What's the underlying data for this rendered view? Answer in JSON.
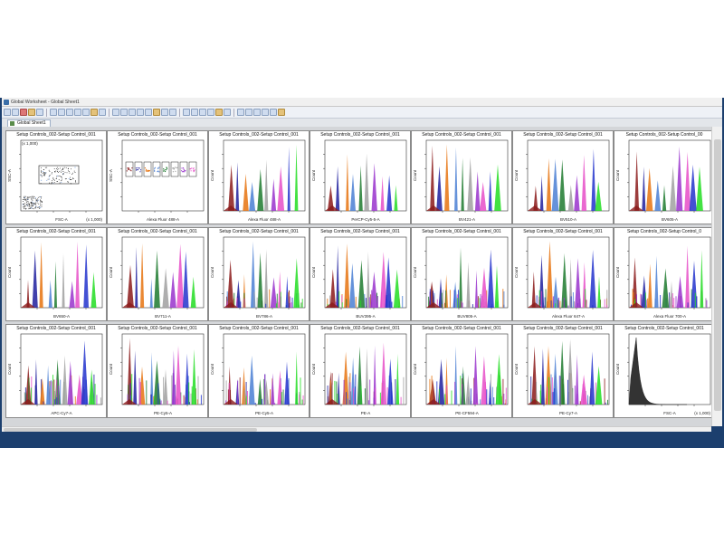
{
  "window": {
    "title": "Global Worksheet - Global Sheet1",
    "tab": "Global Sheet1"
  },
  "toolbar": {
    "buttons": [
      "button",
      "button",
      "button",
      "button",
      "button",
      "button",
      "button",
      "button",
      "button",
      "button",
      "button",
      "button",
      "button",
      "button",
      "button",
      "button",
      "button",
      "button",
      "button",
      "button",
      "button",
      "button",
      "button",
      "button",
      "button",
      "button",
      "button",
      "button",
      "button",
      "button",
      "button",
      "button"
    ]
  },
  "colors": {
    "window_frame": "#1c3f6e",
    "sheet_background": "#d4d6d9",
    "series": [
      "#8b1a1a",
      "#1f1f9e",
      "#e6730f",
      "#4a7fd4",
      "#1d7a2e",
      "#a0a0a0",
      "#9933cc",
      "#e64ec8",
      "#2233cc",
      "#22dd22",
      "#222222"
    ]
  },
  "plots": [
    {
      "title": "Setup Controls_002-Setup Control_001",
      "xaxis": "FSC-A",
      "yaxis": "SSC-A",
      "kind": "scatter",
      "ymult": "(x 1,000)",
      "xmult": "(x 1,000)"
    },
    {
      "title": "Setup Controls_002-Setup Control_001",
      "xaxis": "Alexa Fluor 488-A",
      "yaxis": "SSC-A",
      "kind": "gates"
    },
    {
      "title": "Setup Controls_002-Setup Control_001",
      "xaxis": "Alexa Fluor 488-A",
      "yaxis": "Count",
      "kind": "hist"
    },
    {
      "title": "Setup Controls_002-Setup Control_001",
      "xaxis": "PerCP-Cy5-5-A",
      "yaxis": "Count",
      "kind": "hist"
    },
    {
      "title": "Setup Controls_002-Setup Control_001",
      "xaxis": "BV421-A",
      "yaxis": "Count",
      "kind": "hist"
    },
    {
      "title": "Setup Controls_002-Setup Control_001",
      "xaxis": "BV510-A",
      "yaxis": "Count",
      "kind": "hist"
    },
    {
      "title": "Setup Controls_002-Setup Control_00",
      "xaxis": "BV605-A",
      "yaxis": "Count",
      "kind": "hist"
    },
    {
      "title": "Setup Controls_002-Setup Control_001",
      "xaxis": "BV650-A",
      "yaxis": "Count",
      "kind": "hist"
    },
    {
      "title": "Setup Controls_002-Setup Control_001",
      "xaxis": "BV711-A",
      "yaxis": "Count",
      "kind": "hist"
    },
    {
      "title": "Setup Controls_002-Setup Control_001",
      "xaxis": "BV786-A",
      "yaxis": "Count",
      "kind": "hist"
    },
    {
      "title": "Setup Controls_002-Setup Control_001",
      "xaxis": "BUV395-A",
      "yaxis": "Count",
      "kind": "hist"
    },
    {
      "title": "Setup Controls_002-Setup Control_001",
      "xaxis": "BUV805-A",
      "yaxis": "Count",
      "kind": "hist"
    },
    {
      "title": "Setup Controls_002-Setup Control_001",
      "xaxis": "Alexa Fluor 647-A",
      "yaxis": "Count",
      "kind": "hist"
    },
    {
      "title": "Setup Controls_002-Setup Control_0",
      "xaxis": "Alexa Fluor 700-A",
      "yaxis": "Count",
      "kind": "hist"
    },
    {
      "title": "Setup Controls_002-Setup Control_001",
      "xaxis": "APC-Cy7-A",
      "yaxis": "Count",
      "kind": "hist"
    },
    {
      "title": "Setup Controls_002-Setup Control_001",
      "xaxis": "PE-Cy5-A",
      "yaxis": "Count",
      "kind": "hist"
    },
    {
      "title": "Setup Controls_002-Setup Control_001",
      "xaxis": "PE-Cy5-A",
      "yaxis": "Count",
      "kind": "hist"
    },
    {
      "title": "Setup Controls_002-Setup Control_001",
      "xaxis": "PE-A",
      "yaxis": "Count",
      "kind": "hist"
    },
    {
      "title": "Setup Controls_002-Setup Control_001",
      "xaxis": "PE-CF594-A",
      "yaxis": "Count",
      "kind": "hist"
    },
    {
      "title": "Setup Controls_002-Setup Control_001",
      "xaxis": "PE-Cy7-A",
      "yaxis": "Count",
      "kind": "hist"
    },
    {
      "title": "Setup Controls_002-Setup Control_001",
      "xaxis": "FSC-A",
      "yaxis": "Count",
      "kind": "fsc",
      "xmult": "(x 1,000)"
    }
  ]
}
